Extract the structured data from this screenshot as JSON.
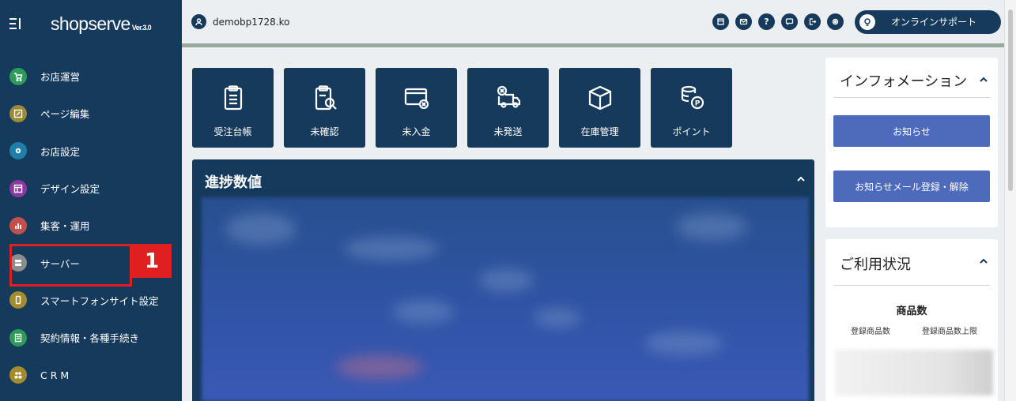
{
  "brand": {
    "name": "shopserve",
    "version": "Ver.3.0"
  },
  "sidebar": {
    "items": [
      {
        "label": "お店運営",
        "color": "#2e9b5b"
      },
      {
        "label": "ページ編集",
        "color": "#9b8a3a"
      },
      {
        "label": "お店設定",
        "color": "#1e7fa8"
      },
      {
        "label": "デザイン設定",
        "color": "#8a3aa0"
      },
      {
        "label": "集客・運用",
        "color": "#c0504d"
      },
      {
        "label": "サーバー",
        "color": "#8c8c8c"
      },
      {
        "label": "スマートフォンサイト設定",
        "color": "#a38b2e"
      },
      {
        "label": "契約情報・各種手続き",
        "color": "#2e9b5b"
      },
      {
        "label": "CRM",
        "color": "#a38b2e"
      }
    ]
  },
  "annotation": {
    "badge": "1"
  },
  "header": {
    "username": "demobp1728.ko",
    "help_icon": "?",
    "support_label": "オンラインサポート"
  },
  "tiles": [
    {
      "label": "受注台帳",
      "icon": "clipboard-list-icon"
    },
    {
      "label": "未確認",
      "icon": "clipboard-search-icon"
    },
    {
      "label": "未入金",
      "icon": "card-cancel-icon"
    },
    {
      "label": "未発送",
      "icon": "truck-cancel-icon"
    },
    {
      "label": "在庫管理",
      "icon": "box-icon"
    },
    {
      "label": "ポイント",
      "icon": "coins-icon"
    }
  ],
  "progress": {
    "title": "進捗数値"
  },
  "info_panel": {
    "title": "インフォメーション",
    "news_button": "お知らせ",
    "mail_button": "お知らせメール登録・解除"
  },
  "usage_panel": {
    "title": "ご利用状況",
    "subtitle": "商品数",
    "col1": "登録商品数",
    "col2": "登録商品数上限"
  },
  "colors": {
    "navy": "#163a5b",
    "accent_blue": "#4d6bba",
    "highlight_red": "#e02020"
  }
}
